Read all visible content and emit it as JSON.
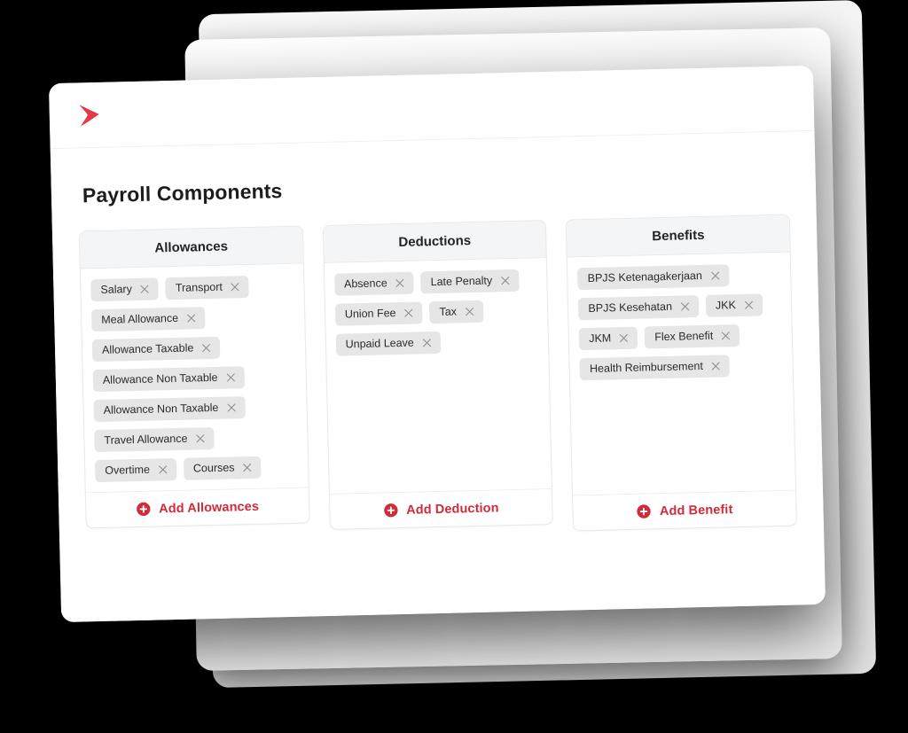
{
  "theme": {
    "accent_red": "#cf2b39",
    "logo_red": "#e03b46",
    "chip_bg": "#e6e6e6",
    "column_header_bg": "#f4f5f6",
    "page_bg": "#000000",
    "card_bg": "#ffffff"
  },
  "window": {
    "logo_name": "red-chevron-logo",
    "page_title": "Payroll Components"
  },
  "columns": [
    {
      "key": "allowances",
      "title": "Allowances",
      "chips": [
        {
          "label": "Salary"
        },
        {
          "label": "Transport"
        },
        {
          "label": "Meal Allowance"
        },
        {
          "label": "Allowance Taxable"
        },
        {
          "label": "Allowance Non Taxable"
        },
        {
          "label": "Allowance Non Taxable"
        },
        {
          "label": "Travel Allowance"
        },
        {
          "label": "Overtime"
        },
        {
          "label": "Courses"
        }
      ],
      "footer_label": "Add Allowances"
    },
    {
      "key": "deductions",
      "title": "Deductions",
      "chips": [
        {
          "label": "Absence"
        },
        {
          "label": "Late Penalty"
        },
        {
          "label": "Union Fee"
        },
        {
          "label": "Tax"
        },
        {
          "label": "Unpaid Leave"
        }
      ],
      "footer_label": "Add Deduction"
    },
    {
      "key": "benefits",
      "title": "Benefits",
      "chips": [
        {
          "label": "BPJS Ketenagakerjaan"
        },
        {
          "label": "BPJS Kesehatan"
        },
        {
          "label": "JKK"
        },
        {
          "label": "JKM"
        },
        {
          "label": "Flex Benefit"
        },
        {
          "label": "Health Reimbursement"
        }
      ],
      "footer_label": "Add Benefit"
    }
  ]
}
